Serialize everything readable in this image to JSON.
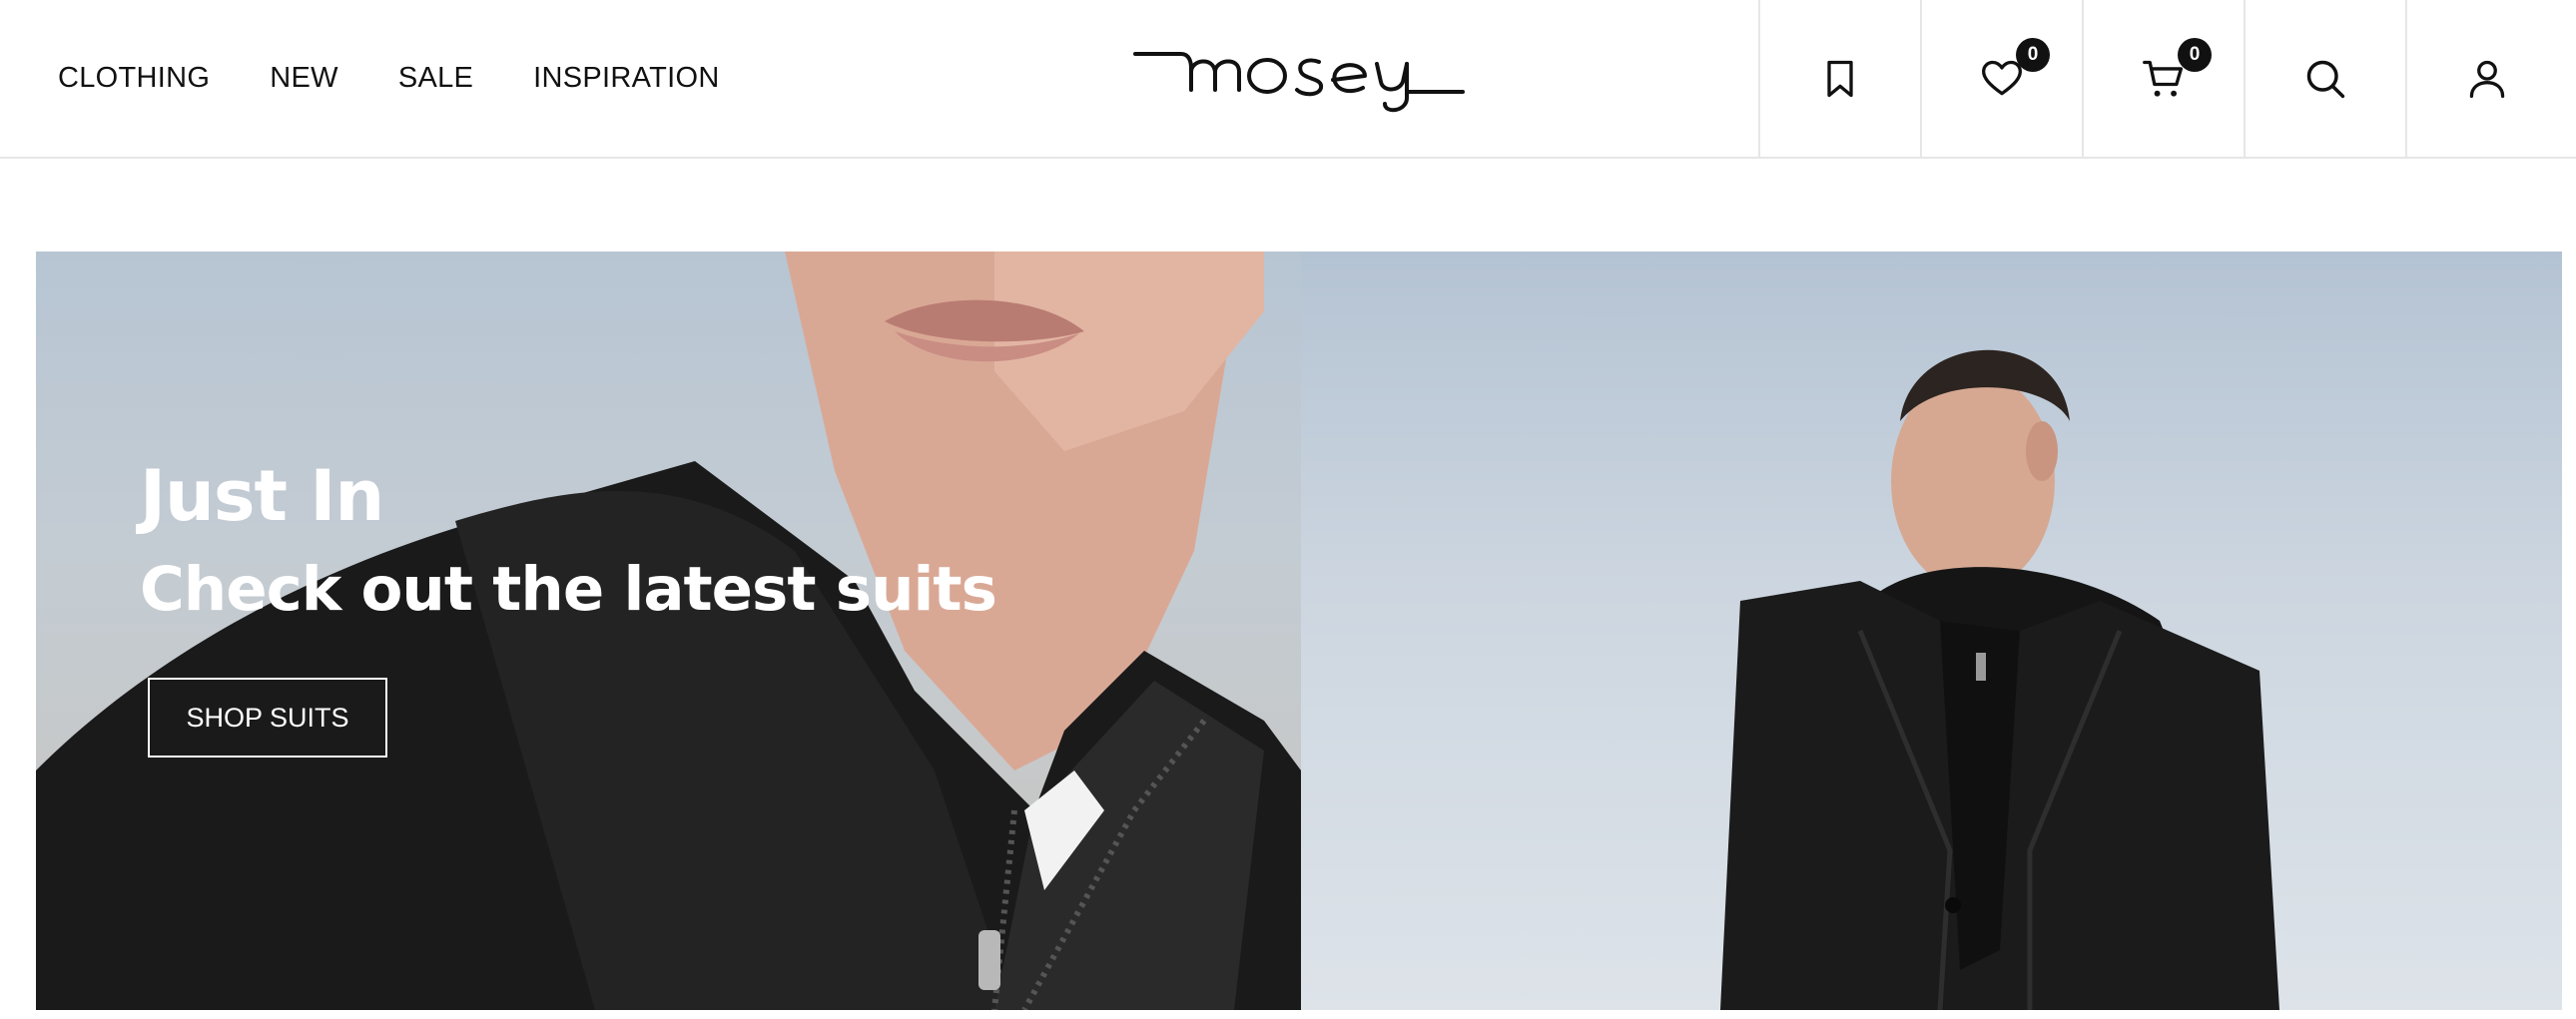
{
  "header": {
    "nav": [
      "CLOTHING",
      "NEW",
      "SALE",
      "INSPIRATION"
    ],
    "logo_text": "mosey",
    "icons": [
      {
        "name": "bookmark-icon"
      },
      {
        "name": "heart-icon",
        "badge": "0"
      },
      {
        "name": "cart-icon",
        "badge": "0"
      },
      {
        "name": "search-icon"
      },
      {
        "name": "user-icon"
      }
    ]
  },
  "hero": {
    "title": "Just In",
    "subtitle": "Check out the latest suits",
    "button_label": "SHOP SUITS"
  },
  "colors": {
    "text": "#111111",
    "badge_bg": "#111111",
    "border": "#e6e6e6",
    "hero_text": "#ffffff"
  }
}
